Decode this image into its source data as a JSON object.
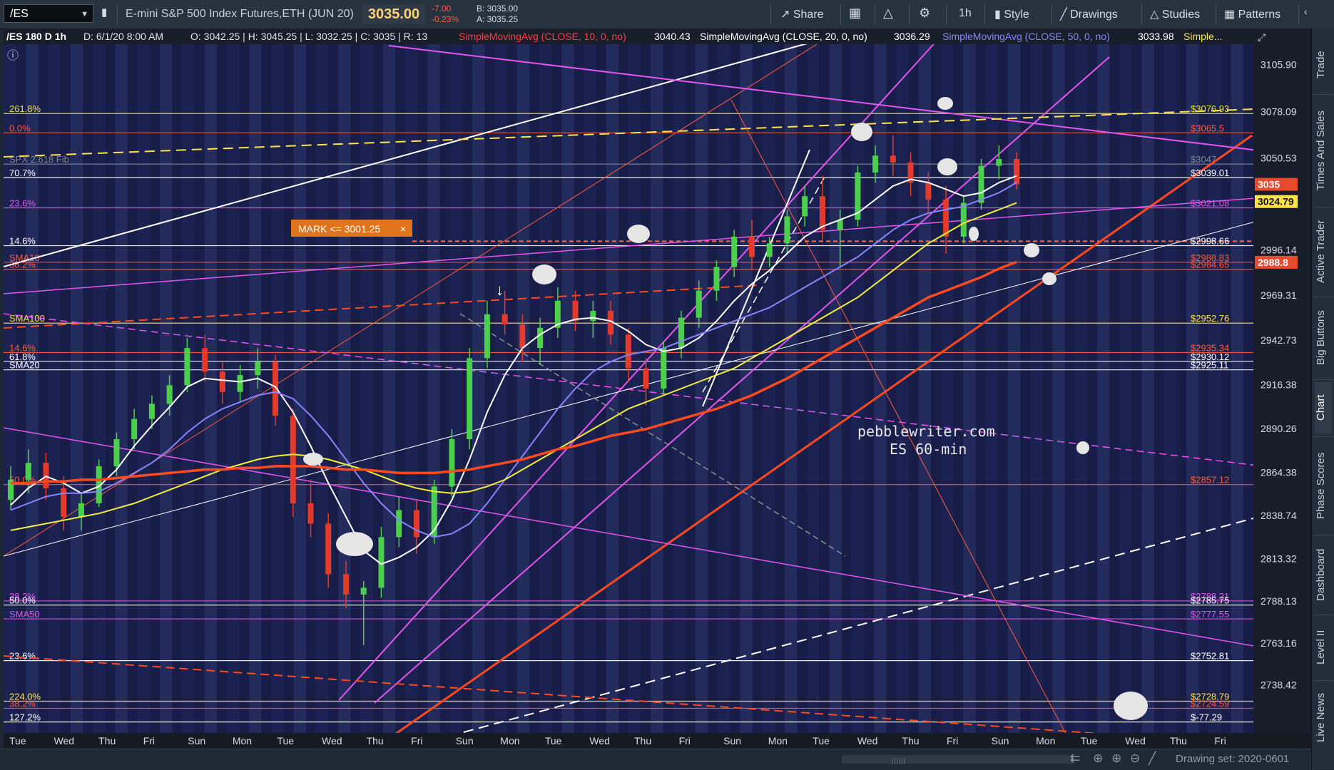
{
  "toolbar": {
    "symbol": "/ES",
    "description": "E-mini S&P 500 Index Futures,ETH (JUN 20)",
    "last": "3035.00",
    "change": "-7.00",
    "change_pct": "-0.23%",
    "bid": "B: 3035.00",
    "ask": "A: 3035.25",
    "share": "Share",
    "interval": "1h",
    "style": "Style",
    "drawings": "Drawings",
    "studies": "Studies",
    "patterns": "Patterns",
    "colors": {
      "up": "#4ccf4c",
      "down": "#e23b2c",
      "accent": "#ffd27a"
    }
  },
  "header": {
    "bar_info": "/ES 180 D 1h",
    "date": "D: 6/1/20 8:00 AM",
    "ohlc": "O: 3042.25 | H: 3045.25 | L: 3032.25 | C: 3035 | R: 13",
    "sma10_label": "SimpleMovingAvg (CLOSE, 10, 0, no)",
    "sma10_value": "3040.43",
    "sma20_label": "SimpleMovingAvg (CLOSE, 20, 0, no)",
    "sma20_value": "3036.29",
    "sma50_label": "SimpleMovingAvg (CLOSE, 50, 0, no)",
    "sma50_value": "3033.98",
    "more": "Simple..."
  },
  "right_tabs": [
    "Trade",
    "Times And Sales",
    "Active Trader",
    "Big Buttons",
    "Chart",
    "Phase Scores",
    "Dashboard",
    "Level II",
    "Live News"
  ],
  "bottom": {
    "drawing_set": "Drawing set: 2020-0601"
  },
  "chart_data": {
    "type": "line",
    "title": "",
    "xlabel": "",
    "ylabel": "",
    "watermark": [
      "pebblewriter.com",
      "ES 60-min"
    ],
    "ylim": [
      2710,
      3118
    ],
    "y_ticks": [
      3105.9,
      3078.09,
      3050.53,
      2996.14,
      2969.31,
      2942.73,
      2916.38,
      2890.26,
      2864.38,
      2838.74,
      2813.32,
      2788.13,
      2763.16,
      2738.42
    ],
    "x_ticks": [
      "Tue",
      "Wed",
      "Thu",
      "Fri",
      "Sun",
      "Mon",
      "Tue",
      "Wed",
      "Thu",
      "Fri",
      "Sun",
      "Mon",
      "Tue",
      "Wed",
      "Thu",
      "Fri",
      "Sun",
      "Mon",
      "Tue",
      "Wed",
      "Thu",
      "Fri",
      "Sun",
      "Mon",
      "Tue",
      "Wed",
      "Thu",
      "Fri"
    ],
    "last_price": {
      "value": 3035,
      "label": "3035",
      "color": "#e84a2f"
    },
    "price_tags": [
      {
        "value": 3024.79,
        "label": "3024.79",
        "color": "#ffe34a"
      },
      {
        "value": 2988.8,
        "label": "2988.8",
        "color": "#e84a2f"
      }
    ],
    "mark_order": {
      "value": 3001.25,
      "label": "MARK <= 3001.25"
    },
    "levels": [
      {
        "value": 3076.93,
        "left": "261.8%",
        "right": "$3076.93",
        "color": "#e6e24a"
      },
      {
        "value": 3065.5,
        "left": "0.0%",
        "right": "$3065.5",
        "color": "#ff5a3c"
      },
      {
        "value": 3047,
        "left": "SPX 2.618 Fib",
        "right": "$3047",
        "color": "#7d8793"
      },
      {
        "value": 3039.01,
        "left": "70.7%",
        "right": "$3039.01",
        "color": "#ffffff"
      },
      {
        "value": 3021.08,
        "left": "23.6%",
        "right": "$3021.08",
        "color": "#e255ee"
      },
      {
        "value": 2998.66,
        "left": "14.6%",
        "right": "$2998.66",
        "color": "#ffffff"
      },
      {
        "value": 2988.83,
        "left": "SMA10",
        "right": "$2988.83",
        "color": "#ff5a3c"
      },
      {
        "value": 2984.65,
        "left": "38.2%",
        "right": "$2984.65",
        "color": "#ff5a3c"
      },
      {
        "value": 2952.76,
        "left": "SMA100",
        "right": "$2952.76",
        "color": "#ffe34a"
      },
      {
        "value": 2935.34,
        "left": "14.6%",
        "right": "$2935.34",
        "color": "#ff5a3c"
      },
      {
        "value": 2930.12,
        "left": "61.8%",
        "right": "$2930.12",
        "color": "#ffffff"
      },
      {
        "value": 2925.11,
        "left": "SMA20",
        "right": "$2925.11",
        "color": "#ffffff"
      },
      {
        "value": 2857.12,
        "left": "50.0%",
        "right": "$2857.12",
        "color": "#ff5a3c"
      },
      {
        "value": 2788.21,
        "left": "38.2%",
        "right": "$2788.21",
        "color": "#e255ee"
      },
      {
        "value": 2785.75,
        "left": "50.0%",
        "right": "$2785.75",
        "color": "#ffffff"
      },
      {
        "value": 2777.55,
        "left": "SMA50",
        "right": "$2777.55",
        "color": "#e255ee"
      },
      {
        "value": 2752.81,
        "left": "23.6%",
        "right": "$2752.81",
        "color": "#ffffff"
      },
      {
        "value": 2728.79,
        "left": "224.0%",
        "right": "$2728.79",
        "color": "#ffe34a"
      },
      {
        "value": 2724.59,
        "left": "38.2%",
        "right": "$2724.59",
        "color": "#ff5a3c"
      },
      {
        "value": 2716.5,
        "left": "127.2%",
        "right": "$-77.29",
        "color": "#ffffff"
      }
    ],
    "series": [
      {
        "name": "/ES",
        "color": "#4ccf4c",
        "ohlc": [
          [
            2848,
            2868,
            2842,
            2860
          ],
          [
            2860,
            2878,
            2852,
            2870
          ],
          [
            2870,
            2876,
            2848,
            2855
          ],
          [
            2855,
            2862,
            2830,
            2838
          ],
          [
            2838,
            2852,
            2830,
            2846
          ],
          [
            2846,
            2872,
            2844,
            2868
          ],
          [
            2868,
            2888,
            2862,
            2884
          ],
          [
            2884,
            2902,
            2878,
            2896
          ],
          [
            2896,
            2910,
            2890,
            2905
          ],
          [
            2905,
            2922,
            2898,
            2916
          ],
          [
            2916,
            2944,
            2912,
            2938
          ],
          [
            2938,
            2946,
            2918,
            2924
          ],
          [
            2924,
            2930,
            2905,
            2912
          ],
          [
            2912,
            2928,
            2906,
            2922
          ],
          [
            2922,
            2938,
            2914,
            2930
          ],
          [
            2930,
            2934,
            2892,
            2898
          ],
          [
            2898,
            2902,
            2838,
            2846
          ],
          [
            2846,
            2860,
            2826,
            2834
          ],
          [
            2834,
            2840,
            2796,
            2804
          ],
          [
            2804,
            2812,
            2784,
            2792
          ],
          [
            2792,
            2800,
            2762,
            2796
          ],
          [
            2796,
            2832,
            2790,
            2826
          ],
          [
            2826,
            2850,
            2820,
            2842
          ],
          [
            2842,
            2848,
            2816,
            2826
          ],
          [
            2826,
            2860,
            2822,
            2856
          ],
          [
            2856,
            2890,
            2850,
            2884
          ],
          [
            2884,
            2938,
            2878,
            2932
          ],
          [
            2932,
            2966,
            2926,
            2958
          ],
          [
            2958,
            2972,
            2946,
            2952
          ],
          [
            2952,
            2958,
            2930,
            2938
          ],
          [
            2938,
            2956,
            2928,
            2950
          ],
          [
            2950,
            2974,
            2944,
            2966
          ],
          [
            2966,
            2972,
            2948,
            2954
          ],
          [
            2954,
            2966,
            2944,
            2960
          ],
          [
            2960,
            2966,
            2940,
            2946
          ],
          [
            2946,
            2950,
            2918,
            2926
          ],
          [
            2926,
            2932,
            2904,
            2914
          ],
          [
            2914,
            2942,
            2910,
            2938
          ],
          [
            2938,
            2960,
            2932,
            2956
          ],
          [
            2956,
            2978,
            2950,
            2972
          ],
          [
            2972,
            2990,
            2966,
            2986
          ],
          [
            2986,
            3008,
            2980,
            3004
          ],
          [
            3004,
            3014,
            2984,
            2992
          ],
          [
            2992,
            3004,
            2986,
            3000
          ],
          [
            3000,
            3020,
            2994,
            3016
          ],
          [
            3016,
            3034,
            3010,
            3028
          ],
          [
            3028,
            3040,
            3002,
            3008
          ],
          [
            3008,
            3020,
            2986,
            3014
          ],
          [
            3014,
            3046,
            3010,
            3042
          ],
          [
            3042,
            3058,
            3036,
            3052
          ],
          [
            3052,
            3064,
            3040,
            3048
          ],
          [
            3048,
            3054,
            3028,
            3036
          ],
          [
            3036,
            3042,
            3018,
            3026
          ],
          [
            3026,
            3034,
            2994,
            3004
          ],
          [
            3004,
            3028,
            3000,
            3024
          ],
          [
            3024,
            3050,
            3020,
            3046
          ],
          [
            3046,
            3058,
            3038,
            3050
          ],
          [
            3050,
            3054,
            3032,
            3035
          ]
        ]
      },
      {
        "name": "SMA10",
        "color": "#ffffff",
        "values": [
          2845,
          2855,
          2862,
          2858,
          2852,
          2856,
          2866,
          2880,
          2892,
          2903,
          2915,
          2920,
          2919,
          2918,
          2920,
          2915,
          2900,
          2880,
          2858,
          2838,
          2818,
          2810,
          2814,
          2820,
          2830,
          2848,
          2872,
          2900,
          2922,
          2938,
          2946,
          2952,
          2955,
          2956,
          2954,
          2948,
          2940,
          2936,
          2938,
          2944,
          2954,
          2966,
          2976,
          2984,
          2994,
          3004,
          3010,
          3014,
          3018,
          3026,
          3034,
          3038,
          3036,
          3032,
          3028,
          3030,
          3036,
          3040
        ]
      },
      {
        "name": "SMA20",
        "color": "#8a83ff",
        "values": [
          2842,
          2846,
          2850,
          2852,
          2852,
          2853,
          2858,
          2864,
          2870,
          2878,
          2888,
          2896,
          2902,
          2906,
          2910,
          2912,
          2908,
          2898,
          2886,
          2872,
          2858,
          2846,
          2836,
          2830,
          2826,
          2828,
          2834,
          2846,
          2860,
          2874,
          2888,
          2902,
          2914,
          2924,
          2930,
          2934,
          2936,
          2938,
          2942,
          2946,
          2950,
          2954,
          2958,
          2962,
          2968,
          2974,
          2980,
          2986,
          2992,
          3000,
          3008,
          3014,
          3018,
          3020,
          3022,
          3026,
          3030,
          3036
        ]
      },
      {
        "name": "SMA50",
        "color": "#f2ee3a",
        "values": [
          2830,
          2832,
          2834,
          2836,
          2838,
          2840,
          2843,
          2846,
          2850,
          2854,
          2858,
          2862,
          2866,
          2869,
          2872,
          2874,
          2875,
          2874,
          2872,
          2869,
          2866,
          2862,
          2858,
          2855,
          2853,
          2852,
          2853,
          2856,
          2860,
          2866,
          2872,
          2878,
          2884,
          2890,
          2896,
          2902,
          2906,
          2910,
          2914,
          2918,
          2922,
          2926,
          2932,
          2938,
          2944,
          2950,
          2956,
          2962,
          2968,
          2976,
          2984,
          2992,
          3000,
          3006,
          3012,
          3016,
          3020,
          3024
        ]
      },
      {
        "name": "SMA100",
        "color": "#ff4a1f",
        "values": [
          2858,
          2858,
          2859,
          2859,
          2860,
          2860,
          2861,
          2862,
          2863,
          2864,
          2865,
          2866,
          2866,
          2867,
          2867,
          2868,
          2868,
          2868,
          2867,
          2866,
          2866,
          2865,
          2864,
          2864,
          2864,
          2865,
          2866,
          2868,
          2870,
          2872,
          2875,
          2878,
          2880,
          2883,
          2886,
          2888,
          2890,
          2893,
          2896,
          2899,
          2902,
          2906,
          2910,
          2915,
          2920,
          2926,
          2932,
          2938,
          2944,
          2950,
          2956,
          2962,
          2968,
          2972,
          2976,
          2980,
          2985,
          2989
        ]
      }
    ]
  }
}
